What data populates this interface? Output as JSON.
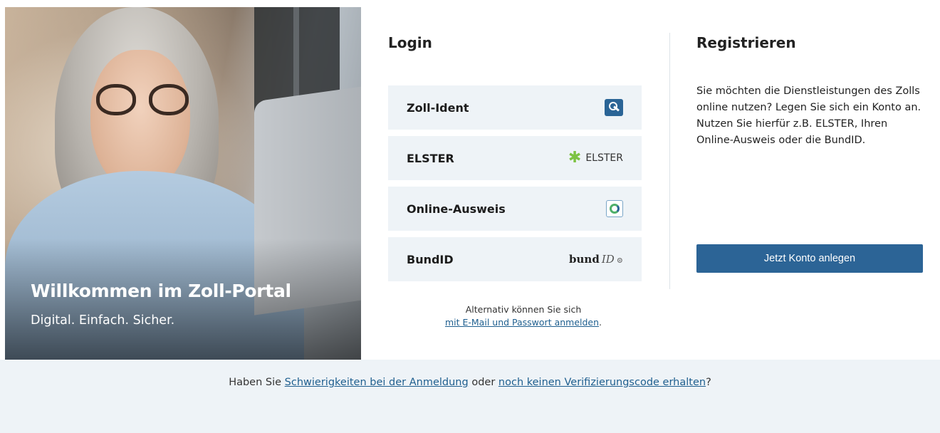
{
  "hero": {
    "title": "Willkommen im Zoll-Portal",
    "subtitle": "Digital. Einfach. Sicher."
  },
  "login": {
    "heading": "Login",
    "options": [
      {
        "label": "Zoll-Ident",
        "icon": "key-icon"
      },
      {
        "label": "ELSTER",
        "icon": "elster-star-icon",
        "logo_text": "ELSTER"
      },
      {
        "label": "Online-Ausweis",
        "icon": "online-ausweis-icon"
      },
      {
        "label": "BundID",
        "icon": "bundid-logo",
        "logo_text": "bund",
        "logo_suffix": "ID"
      }
    ],
    "alt_text": "Alternativ können Sie sich",
    "alt_link": "mit E-Mail und Passwort anmelden",
    "alt_suffix": "."
  },
  "register": {
    "heading": "Registrieren",
    "description": "Sie möchten die Dienstleistungen des Zolls online nutzen? Legen Sie sich ein Konto an. Nutzen Sie hierfür z.B. ELSTER, Ihren Online-Ausweis oder die BundID.",
    "button_label": "Jetzt Konto anlegen"
  },
  "footer": {
    "prefix": "Haben Sie ",
    "link1": "Schwierigkeiten bei der Anmeldung",
    "middle": " oder ",
    "link2": "noch keinen Verifizierungscode erhalten",
    "suffix": "?"
  },
  "colors": {
    "accent": "#2c6496",
    "option_bg": "#eef3f7",
    "footer_bg": "#eef3f7",
    "elster_green": "#7cc242"
  }
}
